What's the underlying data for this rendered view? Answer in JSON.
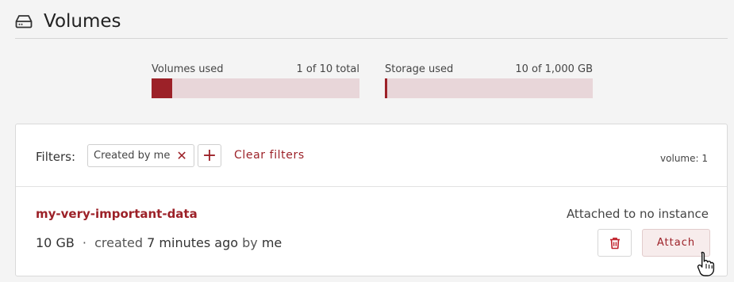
{
  "header": {
    "title": "Volumes",
    "icon": "drive-icon"
  },
  "quota": {
    "volumes": {
      "label": "Volumes used",
      "value_text": "1 of 10 total",
      "used_fraction": 0.1
    },
    "storage": {
      "label": "Storage used",
      "value_text": "10 of 1,000 GB",
      "used_fraction": 0.01
    }
  },
  "filters": {
    "label": "Filters:",
    "chips": [
      {
        "label": "Created by me"
      }
    ],
    "clear_label": "Clear filters",
    "count_text": "volume: 1"
  },
  "volume": {
    "name": "my-very-important-data",
    "size": "10 GB",
    "separator": "·",
    "created_prefix": "created",
    "created_when": "7 minutes ago",
    "created_by_prefix": "by",
    "created_by": "me",
    "status": "Attached to no instance",
    "attach_label": "Attach"
  },
  "colors": {
    "accent": "#9c2128",
    "bar_bg": "#e8d6d9",
    "page_bg": "#f4f4f4"
  }
}
